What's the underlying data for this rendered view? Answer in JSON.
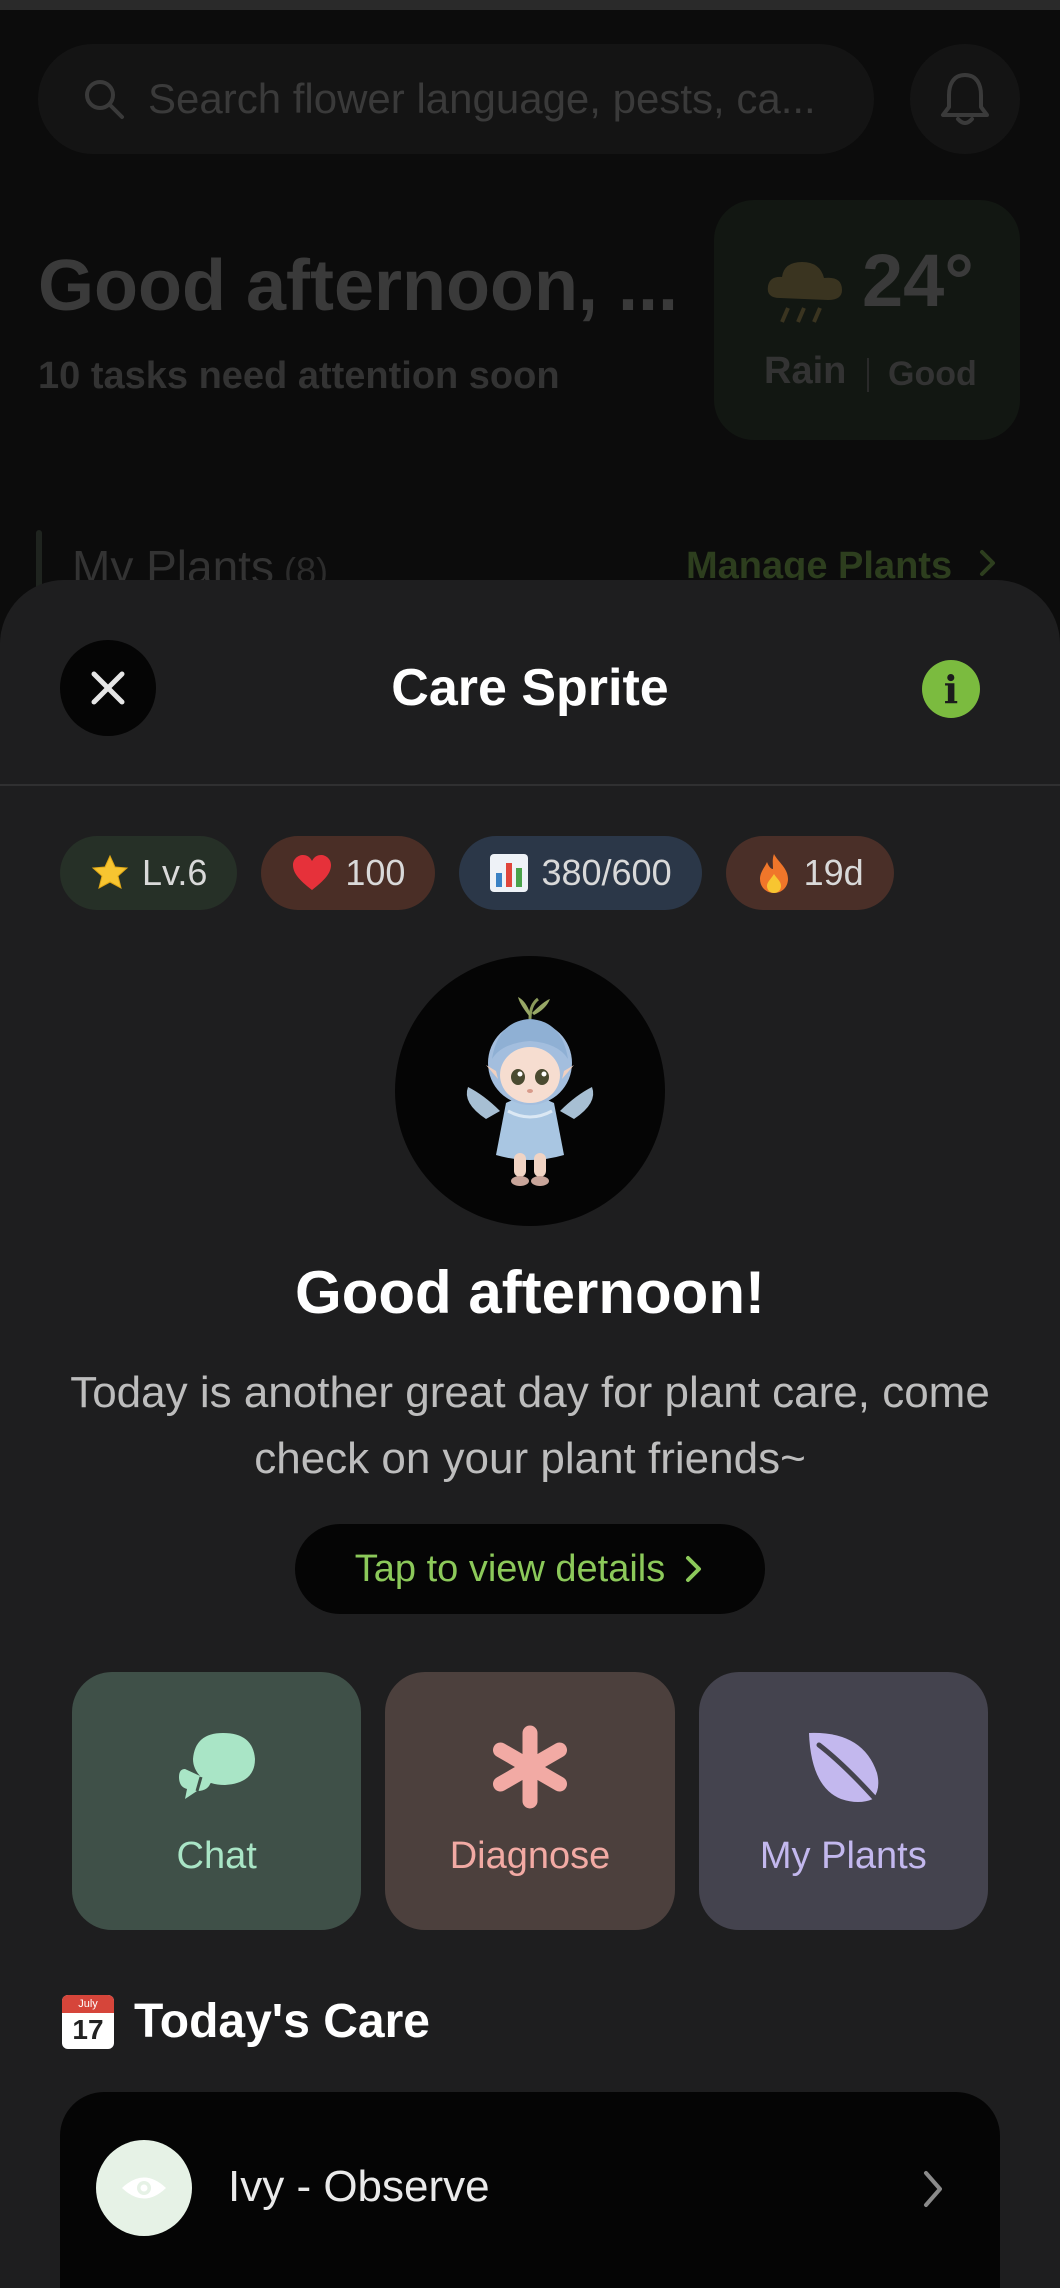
{
  "background": {
    "search": {
      "placeholder": "Search flower language, pests, ca..."
    },
    "greeting": "Good afternoon, ...",
    "tasks_notice": "10 tasks need attention soon",
    "weather": {
      "temperature": "24°",
      "condition": "Rain",
      "quality": "Good",
      "icon": "rain-cloud-icon"
    },
    "plants_section": {
      "title": "My Plants",
      "count": "(8)",
      "manage_label": "Manage Plants"
    }
  },
  "sheet": {
    "title": "Care Sprite",
    "stats": {
      "level": "Lv.6",
      "health": "100",
      "xp": "380/600",
      "streak": "19d"
    },
    "greeting": "Good afternoon!",
    "message": "Today is another great day for plant care, come check on your plant friends~",
    "details_label": "Tap to view details",
    "actions": {
      "chat": "Chat",
      "diagnose": "Diagnose",
      "my_plants": "My Plants"
    },
    "todays_care": {
      "calendar_month": "July",
      "calendar_day": "17",
      "title": "Today's Care",
      "tasks": [
        {
          "label": "Ivy - Observe",
          "icon": "eye-icon"
        }
      ]
    }
  },
  "colors": {
    "accent_green": "#7bbb3f",
    "details_text": "#8cc95a",
    "chat_bg": "#3f5048",
    "diagnose_bg": "#4c403d",
    "plants_bg": "#44434e"
  }
}
